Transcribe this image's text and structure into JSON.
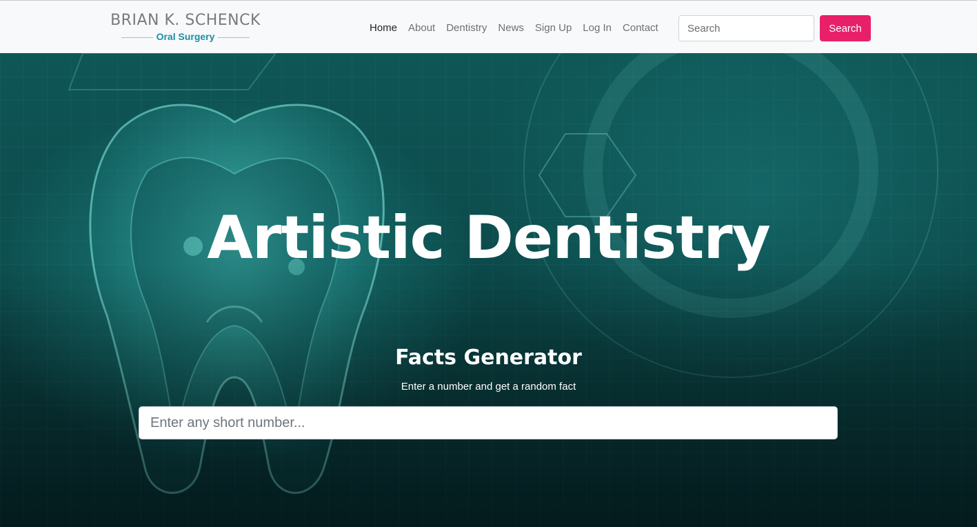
{
  "header": {
    "logo": {
      "line1": "BRIAN K. SCHENCK",
      "line2": "Oral Surgery",
      "accent_color": "#1b8fa3"
    },
    "nav": [
      {
        "label": "Home",
        "active": true
      },
      {
        "label": "About",
        "active": false
      },
      {
        "label": "Dentistry",
        "active": false
      },
      {
        "label": "News",
        "active": false
      },
      {
        "label": "Sign Up",
        "active": false
      },
      {
        "label": "Log In",
        "active": false
      },
      {
        "label": "Contact",
        "active": false
      }
    ],
    "search": {
      "placeholder": "Search",
      "value": "",
      "button_label": "Search",
      "button_color": "#e8206a"
    }
  },
  "hero": {
    "title": "Artistic Dentistry",
    "background_image": "tooth-xray-illustration",
    "facts": {
      "title": "Facts Generator",
      "subtitle": "Enter a number and get a random fact",
      "input_placeholder": "Enter any short number...",
      "input_value": ""
    }
  }
}
